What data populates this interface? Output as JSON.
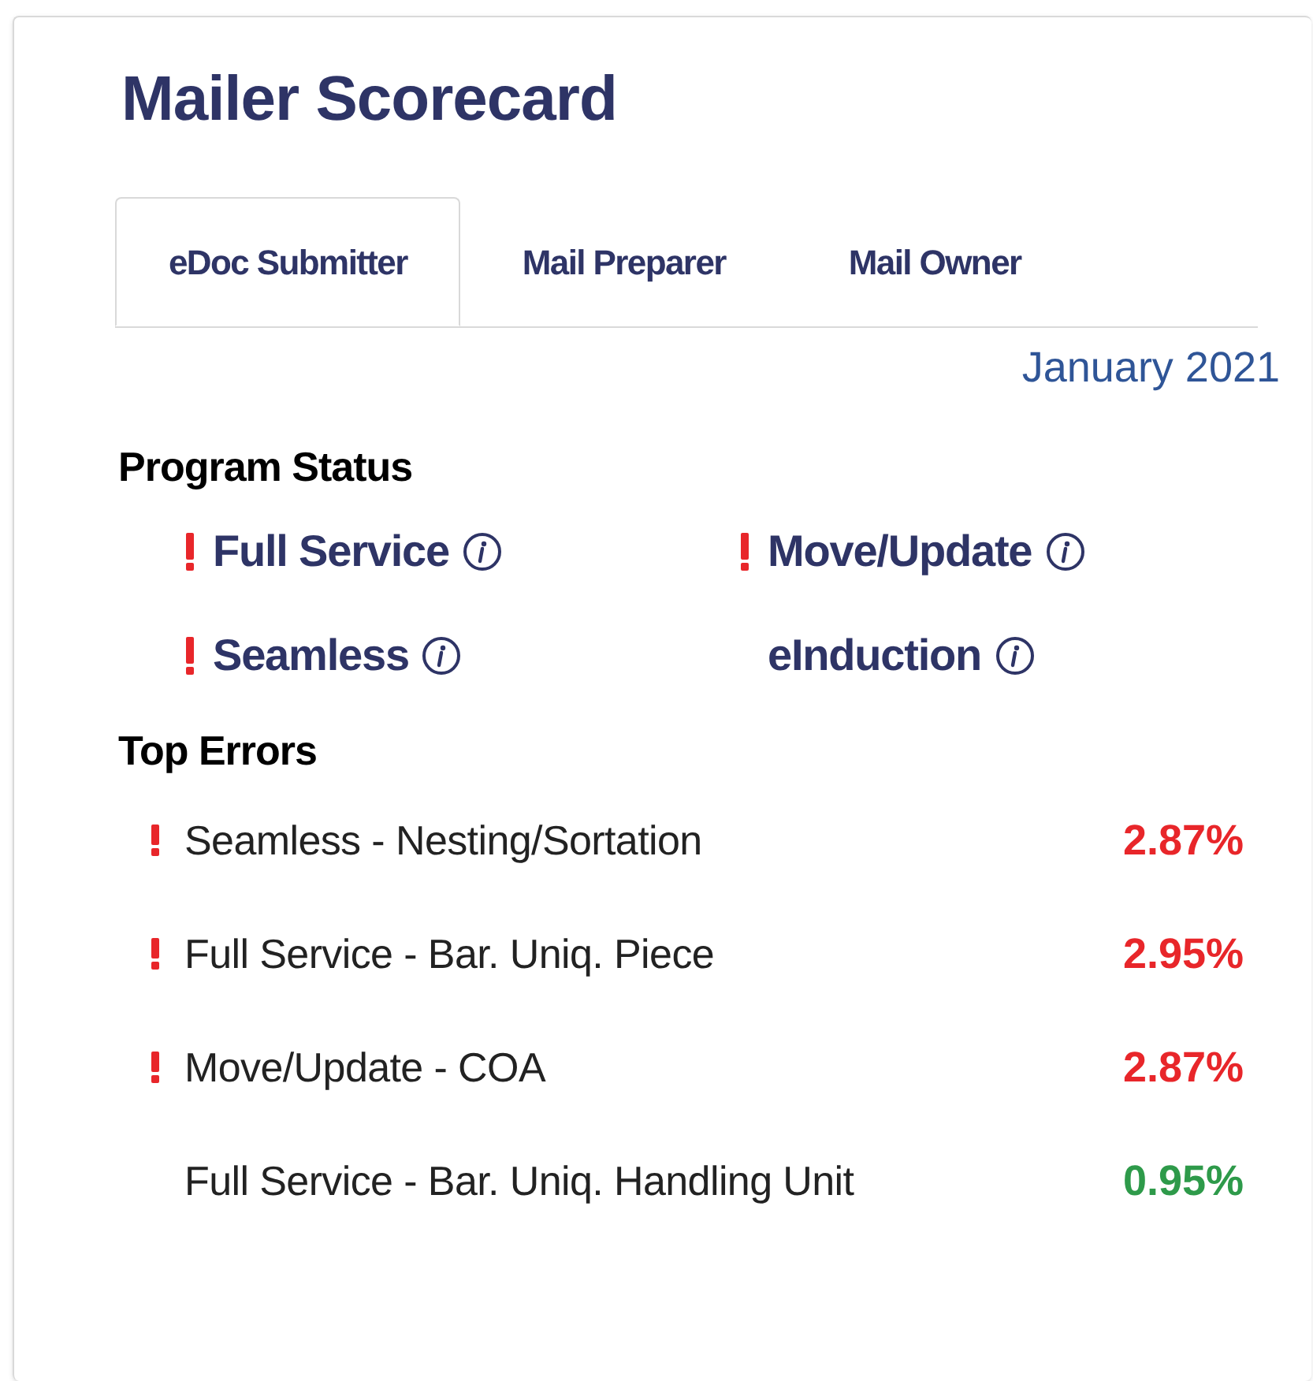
{
  "title": "Mailer Scorecard",
  "tabs": [
    {
      "label": "eDoc Submitter",
      "selected": true
    },
    {
      "label": "Mail Preparer",
      "selected": false
    },
    {
      "label": "Mail Owner",
      "selected": false
    }
  ],
  "period": "January 2021",
  "program_status": {
    "heading": "Program Status",
    "items": [
      {
        "label": "Full Service",
        "alert": true
      },
      {
        "label": "Move/Update",
        "alert": true
      },
      {
        "label": "Seamless",
        "alert": true
      },
      {
        "label": "eInduction",
        "alert": false
      }
    ]
  },
  "top_errors": {
    "heading": "Top Errors",
    "rows": [
      {
        "label": "Seamless - Nesting/Sortation",
        "value": "2.87%",
        "alert": true
      },
      {
        "label": "Full Service - Bar. Uniq. Piece",
        "value": "2.95%",
        "alert": true
      },
      {
        "label": "Move/Update - COA",
        "value": "2.87%",
        "alert": true
      },
      {
        "label": "Full Service - Bar. Uniq. Handling Unit",
        "value": "0.95%",
        "alert": false
      }
    ]
  }
}
